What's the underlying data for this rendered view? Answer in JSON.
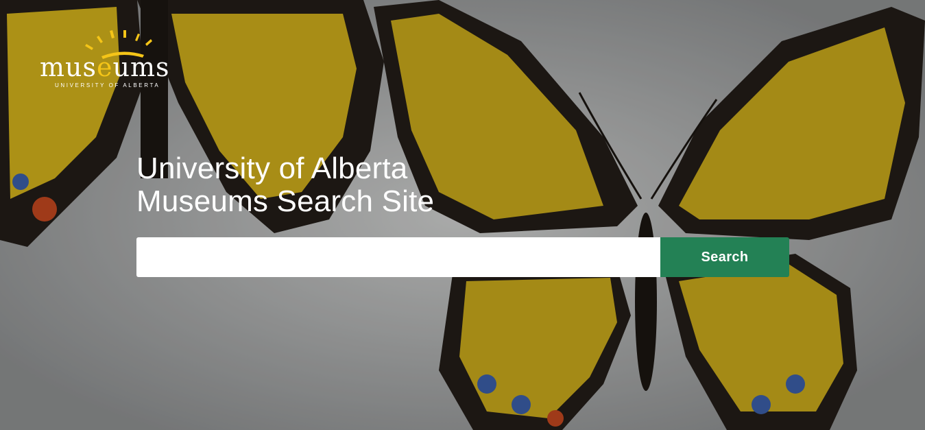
{
  "logo": {
    "word_part1": "mus",
    "word_e": "e",
    "word_part2": "ums",
    "subtitle": "UNIVERSITY OF ALBERTA"
  },
  "hero": {
    "title_line1": "University of Alberta",
    "title_line2": "Museums Search Site"
  },
  "search": {
    "input_value": "",
    "button_label": "Search"
  },
  "colors": {
    "accent_green": "#238155",
    "logo_gold": "#f5c518",
    "butterfly_yellow": "#e6c21c",
    "butterfly_dark": "#231d18"
  }
}
